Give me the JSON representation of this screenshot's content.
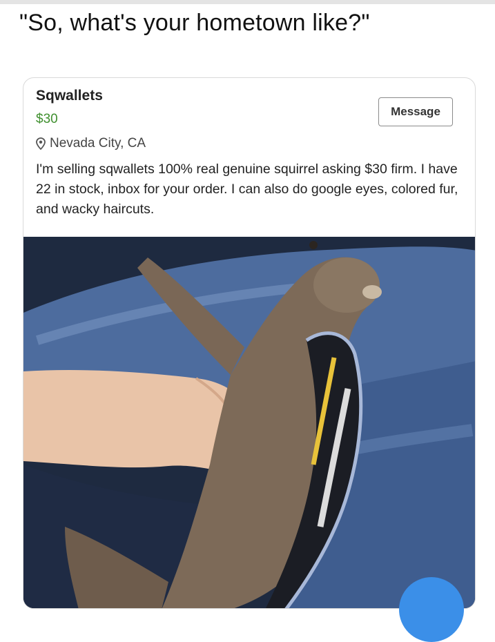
{
  "headline": "\"So, what's your hometown like?\"",
  "listing": {
    "title": "Sqwallets",
    "price": "$30",
    "location": "Nevada City, CA",
    "description": "I'm selling sqwallets 100% real genuine squirrel asking $30 firm. I have 22 in stock, inbox for your order. I can also do google eyes, colored fur, and wacky haircuts.",
    "message_button": "Message",
    "location_icon": "map-pin-icon"
  },
  "colors": {
    "price": "#3f8f2e",
    "fab": "#3b8fe8"
  }
}
